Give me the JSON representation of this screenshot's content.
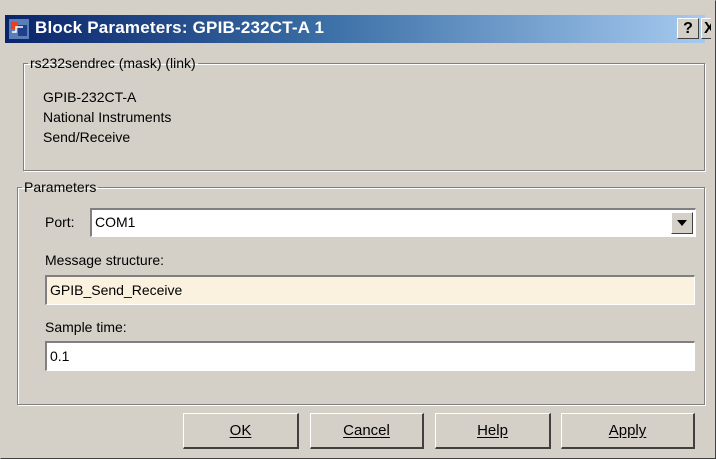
{
  "window": {
    "title": "Block Parameters: GPIB-232CT-A 1",
    "help_button": "?",
    "close_button": "X"
  },
  "description_group": {
    "legend": "rs232sendrec (mask) (link)",
    "lines": [
      "GPIB-232CT-A",
      "National Instruments",
      "Send/Receive"
    ]
  },
  "parameters_group": {
    "legend": "Parameters",
    "port_label": "Port:",
    "port_value": "COM1",
    "message_structure_label": "Message structure:",
    "message_structure_value": "GPIB_Send_Receive",
    "sample_time_label": "Sample time:",
    "sample_time_value": "0.1"
  },
  "buttons": {
    "ok": "OK",
    "cancel": "Cancel",
    "help": "Help",
    "apply": "Apply"
  },
  "colors": {
    "dialog_face": "#d4d0c8",
    "title_gradient_start": "#0a246a",
    "title_gradient_end": "#a6caf0",
    "highlighted_field": "#fbf1df"
  },
  "icons": {
    "app": "simulink-block-icon",
    "combo": "chevron-down-icon"
  }
}
